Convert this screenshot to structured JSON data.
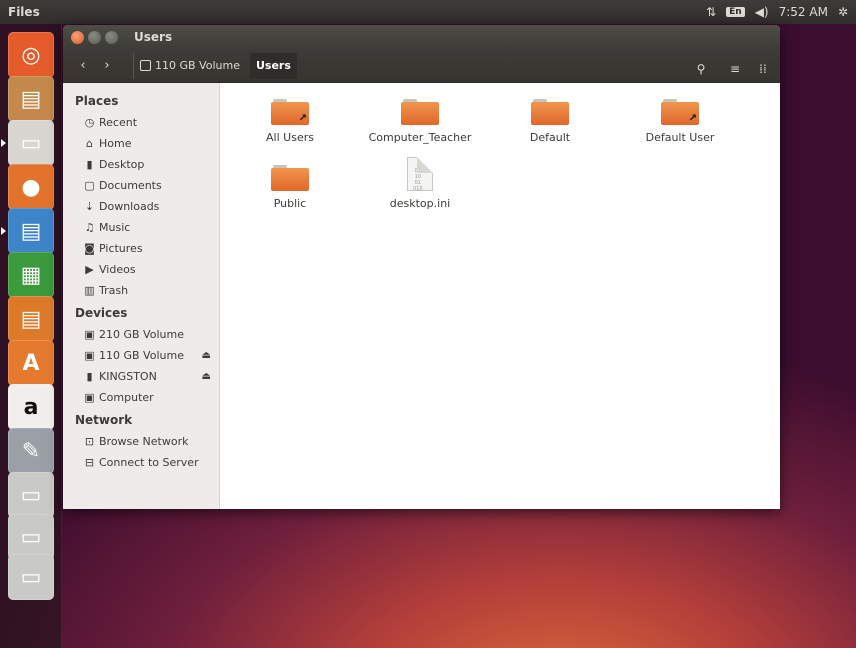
{
  "top_panel": {
    "app_title": "Files",
    "keyboard_layout": "En",
    "time": "7:52 AM"
  },
  "launcher": {
    "items": [
      {
        "name": "ubuntu-dash-icon",
        "color": "#e55b2a"
      },
      {
        "name": "scanner-icon",
        "color": "#c4894a"
      },
      {
        "name": "files-icon",
        "color": "#d8d6d0"
      },
      {
        "name": "firefox-icon",
        "color": "#e2732d"
      },
      {
        "name": "writer-icon",
        "color": "#3e84c8"
      },
      {
        "name": "calc-icon",
        "color": "#3a9a3c"
      },
      {
        "name": "impress-icon",
        "color": "#dd7a2a"
      },
      {
        "name": "software-center-icon",
        "color": "#e57a2e"
      },
      {
        "name": "amazon-icon",
        "color": "#f0efec"
      },
      {
        "name": "settings-icon",
        "color": "#9aa0a6"
      },
      {
        "name": "drive-icon",
        "color": "#c9c9c6"
      },
      {
        "name": "drive-icon-2",
        "color": "#c9c9c6"
      },
      {
        "name": "usb-drive-icon",
        "color": "#c9c9c6"
      }
    ]
  },
  "window": {
    "title": "Users",
    "breadcrumb": {
      "volume": "110 GB Volume",
      "current": "Users"
    }
  },
  "sidebar": {
    "places_label": "Places",
    "places": [
      {
        "label": "Recent",
        "icon": "clock-icon",
        "glyph": "◷"
      },
      {
        "label": "Home",
        "icon": "home-icon",
        "glyph": "⌂"
      },
      {
        "label": "Desktop",
        "icon": "desktop-icon",
        "glyph": "▮"
      },
      {
        "label": "Documents",
        "icon": "documents-icon",
        "glyph": "▢"
      },
      {
        "label": "Downloads",
        "icon": "downloads-icon",
        "glyph": "⇣"
      },
      {
        "label": "Music",
        "icon": "music-icon",
        "glyph": "♫"
      },
      {
        "label": "Pictures",
        "icon": "pictures-icon",
        "glyph": "◙"
      },
      {
        "label": "Videos",
        "icon": "videos-icon",
        "glyph": "▶"
      },
      {
        "label": "Trash",
        "icon": "trash-icon",
        "glyph": "▥"
      }
    ],
    "devices_label": "Devices",
    "devices": [
      {
        "label": "210 GB Volume",
        "icon": "drive-icon",
        "glyph": "▣",
        "eject": false
      },
      {
        "label": "110 GB Volume",
        "icon": "drive-icon",
        "glyph": "▣",
        "eject": true
      },
      {
        "label": "KINGSTON",
        "icon": "usb-icon",
        "glyph": "▮",
        "eject": true
      },
      {
        "label": "Computer",
        "icon": "computer-icon",
        "glyph": "▣",
        "eject": false
      }
    ],
    "network_label": "Network",
    "network": [
      {
        "label": "Browse Network",
        "icon": "network-icon",
        "glyph": "⊡"
      },
      {
        "label": "Connect to Server",
        "icon": "server-icon",
        "glyph": "⊟"
      }
    ]
  },
  "files": [
    {
      "name": "All Users",
      "type": "folder-link"
    },
    {
      "name": "Computer_Teacher",
      "type": "folder"
    },
    {
      "name": "Default",
      "type": "folder"
    },
    {
      "name": "Default User",
      "type": "folder-link"
    },
    {
      "name": "Public",
      "type": "folder"
    },
    {
      "name": "desktop.ini",
      "type": "document"
    }
  ]
}
